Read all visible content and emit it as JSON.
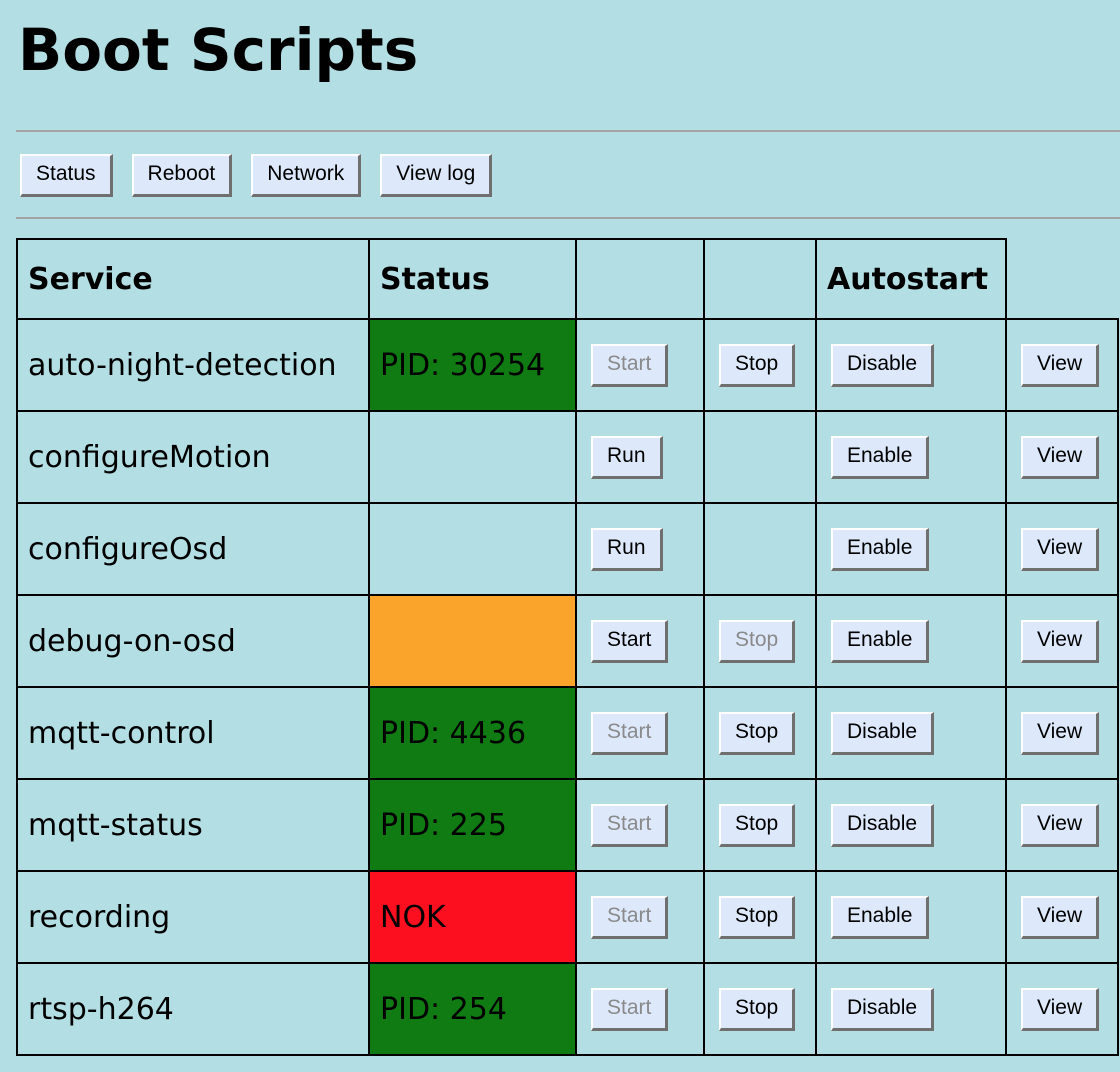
{
  "page": {
    "title": "Boot Scripts"
  },
  "nav": {
    "buttons": [
      {
        "label": "Status"
      },
      {
        "label": "Reboot"
      },
      {
        "label": "Network"
      },
      {
        "label": "View log"
      }
    ]
  },
  "table": {
    "headers": {
      "service": "Service",
      "status": "Status",
      "col3": "",
      "col4": "",
      "autostart": "Autostart",
      "col6": ""
    },
    "rows": [
      {
        "service": "auto-night-detection",
        "status": "PID: 30254",
        "status_color": "#107b12",
        "action1": "Start",
        "action1_disabled": true,
        "action2": "Stop",
        "action2_disabled": false,
        "autostart": "Disable",
        "view": "View"
      },
      {
        "service": "configureMotion",
        "status": "",
        "status_color": "",
        "action1": "Run",
        "action1_disabled": false,
        "action2": "",
        "action2_disabled": false,
        "autostart": "Enable",
        "view": "View"
      },
      {
        "service": "configureOsd",
        "status": "",
        "status_color": "",
        "action1": "Run",
        "action1_disabled": false,
        "action2": "",
        "action2_disabled": false,
        "autostart": "Enable",
        "view": "View"
      },
      {
        "service": "debug-on-osd",
        "status": "",
        "status_color": "#fba42b",
        "action1": "Start",
        "action1_disabled": false,
        "action2": "Stop",
        "action2_disabled": true,
        "autostart": "Enable",
        "view": "View"
      },
      {
        "service": "mqtt-control",
        "status": "PID: 4436",
        "status_color": "#107b12",
        "action1": "Start",
        "action1_disabled": true,
        "action2": "Stop",
        "action2_disabled": false,
        "autostart": "Disable",
        "view": "View"
      },
      {
        "service": "mqtt-status",
        "status": "PID: 225",
        "status_color": "#107b12",
        "action1": "Start",
        "action1_disabled": true,
        "action2": "Stop",
        "action2_disabled": false,
        "autostart": "Disable",
        "view": "View"
      },
      {
        "service": "recording",
        "status": "NOK",
        "status_color": "#fc101f",
        "action1": "Start",
        "action1_disabled": true,
        "action2": "Stop",
        "action2_disabled": false,
        "autostart": "Enable",
        "view": "View"
      },
      {
        "service": "rtsp-h264",
        "status": "PID: 254",
        "status_color": "#107b12",
        "action1": "Start",
        "action1_disabled": true,
        "action2": "Stop",
        "action2_disabled": false,
        "autostart": "Disable",
        "view": "View"
      }
    ]
  }
}
